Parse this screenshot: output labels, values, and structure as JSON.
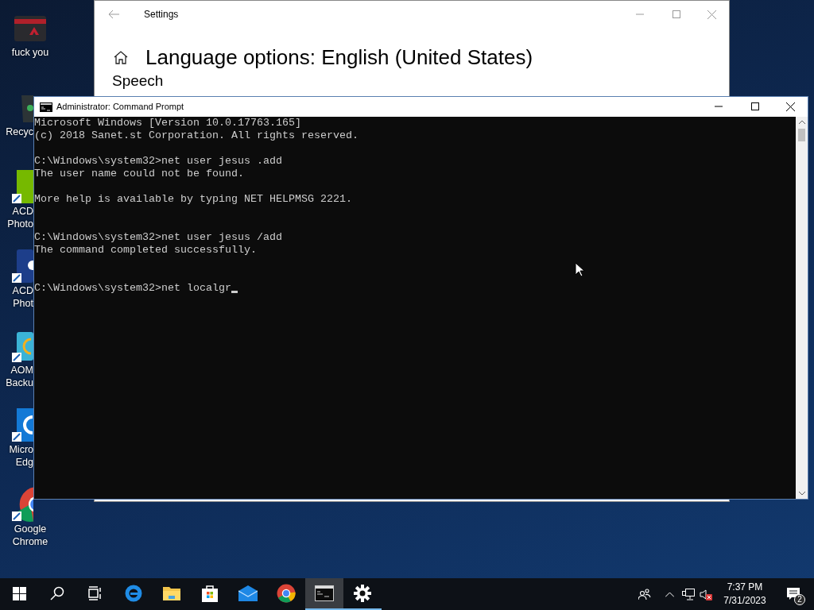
{
  "desktop_icons": [
    {
      "kind": "folder",
      "lines": [
        "fuck you"
      ],
      "clipped": false
    },
    {
      "kind": "recycle",
      "lines": [
        "Recyc"
      ],
      "clipped": true
    },
    {
      "kind": "green-app",
      "lines": [
        "ACD",
        "Photo"
      ],
      "clipped": true
    },
    {
      "kind": "camera-app",
      "lines": [
        "ACD",
        "Phot"
      ],
      "clipped": true
    },
    {
      "kind": "backup-app",
      "lines": [
        "AOM",
        "Backu"
      ],
      "clipped": true
    },
    {
      "kind": "edge",
      "lines": [
        "Micro",
        "Edg"
      ],
      "clipped": true
    },
    {
      "kind": "chrome",
      "lines": [
        "Google",
        "Chrome"
      ],
      "clipped": false
    }
  ],
  "settings_window": {
    "title": "Settings",
    "heading": "Language options: English (United States)",
    "section": "Speech"
  },
  "console_window": {
    "title": "Administrator: Command Prompt",
    "lines": [
      {
        "kind": "text",
        "text": "Microsoft Windows [Version 10.0.17763.165]",
        "cursor": false
      },
      {
        "kind": "text",
        "text": "(c) 2018 Sanet.st Corporation. All rights reserved.",
        "cursor": false
      },
      {
        "kind": "blank"
      },
      {
        "kind": "text",
        "text": "C:\\Windows\\system32>net user jesus .add",
        "cursor": false
      },
      {
        "kind": "text",
        "text": "The user name could not be found.",
        "cursor": false
      },
      {
        "kind": "blank"
      },
      {
        "kind": "text",
        "text": "More help is available by typing NET HELPMSG 2221.",
        "cursor": false
      },
      {
        "kind": "blank"
      },
      {
        "kind": "blank"
      },
      {
        "kind": "text",
        "text": "C:\\Windows\\system32>net user jesus /add",
        "cursor": false
      },
      {
        "kind": "text",
        "text": "The command completed successfully.",
        "cursor": false
      },
      {
        "kind": "blank"
      },
      {
        "kind": "blank"
      },
      {
        "kind": "text",
        "text": "C:\\Windows\\system32>net localgr",
        "cursor": true
      }
    ]
  },
  "taskbar": {
    "items": [
      {
        "kind": "start",
        "selected": false,
        "open": false
      },
      {
        "kind": "search",
        "selected": false,
        "open": false
      },
      {
        "kind": "taskview",
        "selected": false,
        "open": false
      },
      {
        "kind": "edge",
        "selected": false,
        "open": false
      },
      {
        "kind": "explorer",
        "selected": false,
        "open": false
      },
      {
        "kind": "store",
        "selected": false,
        "open": false
      },
      {
        "kind": "mail",
        "selected": false,
        "open": false
      },
      {
        "kind": "chrome",
        "selected": false,
        "open": false
      },
      {
        "kind": "console",
        "selected": true,
        "open": true
      },
      {
        "kind": "settings",
        "selected": false,
        "open": true
      }
    ],
    "time": "7:37 PM",
    "date": "7/31/2023",
    "notifications": "2"
  }
}
